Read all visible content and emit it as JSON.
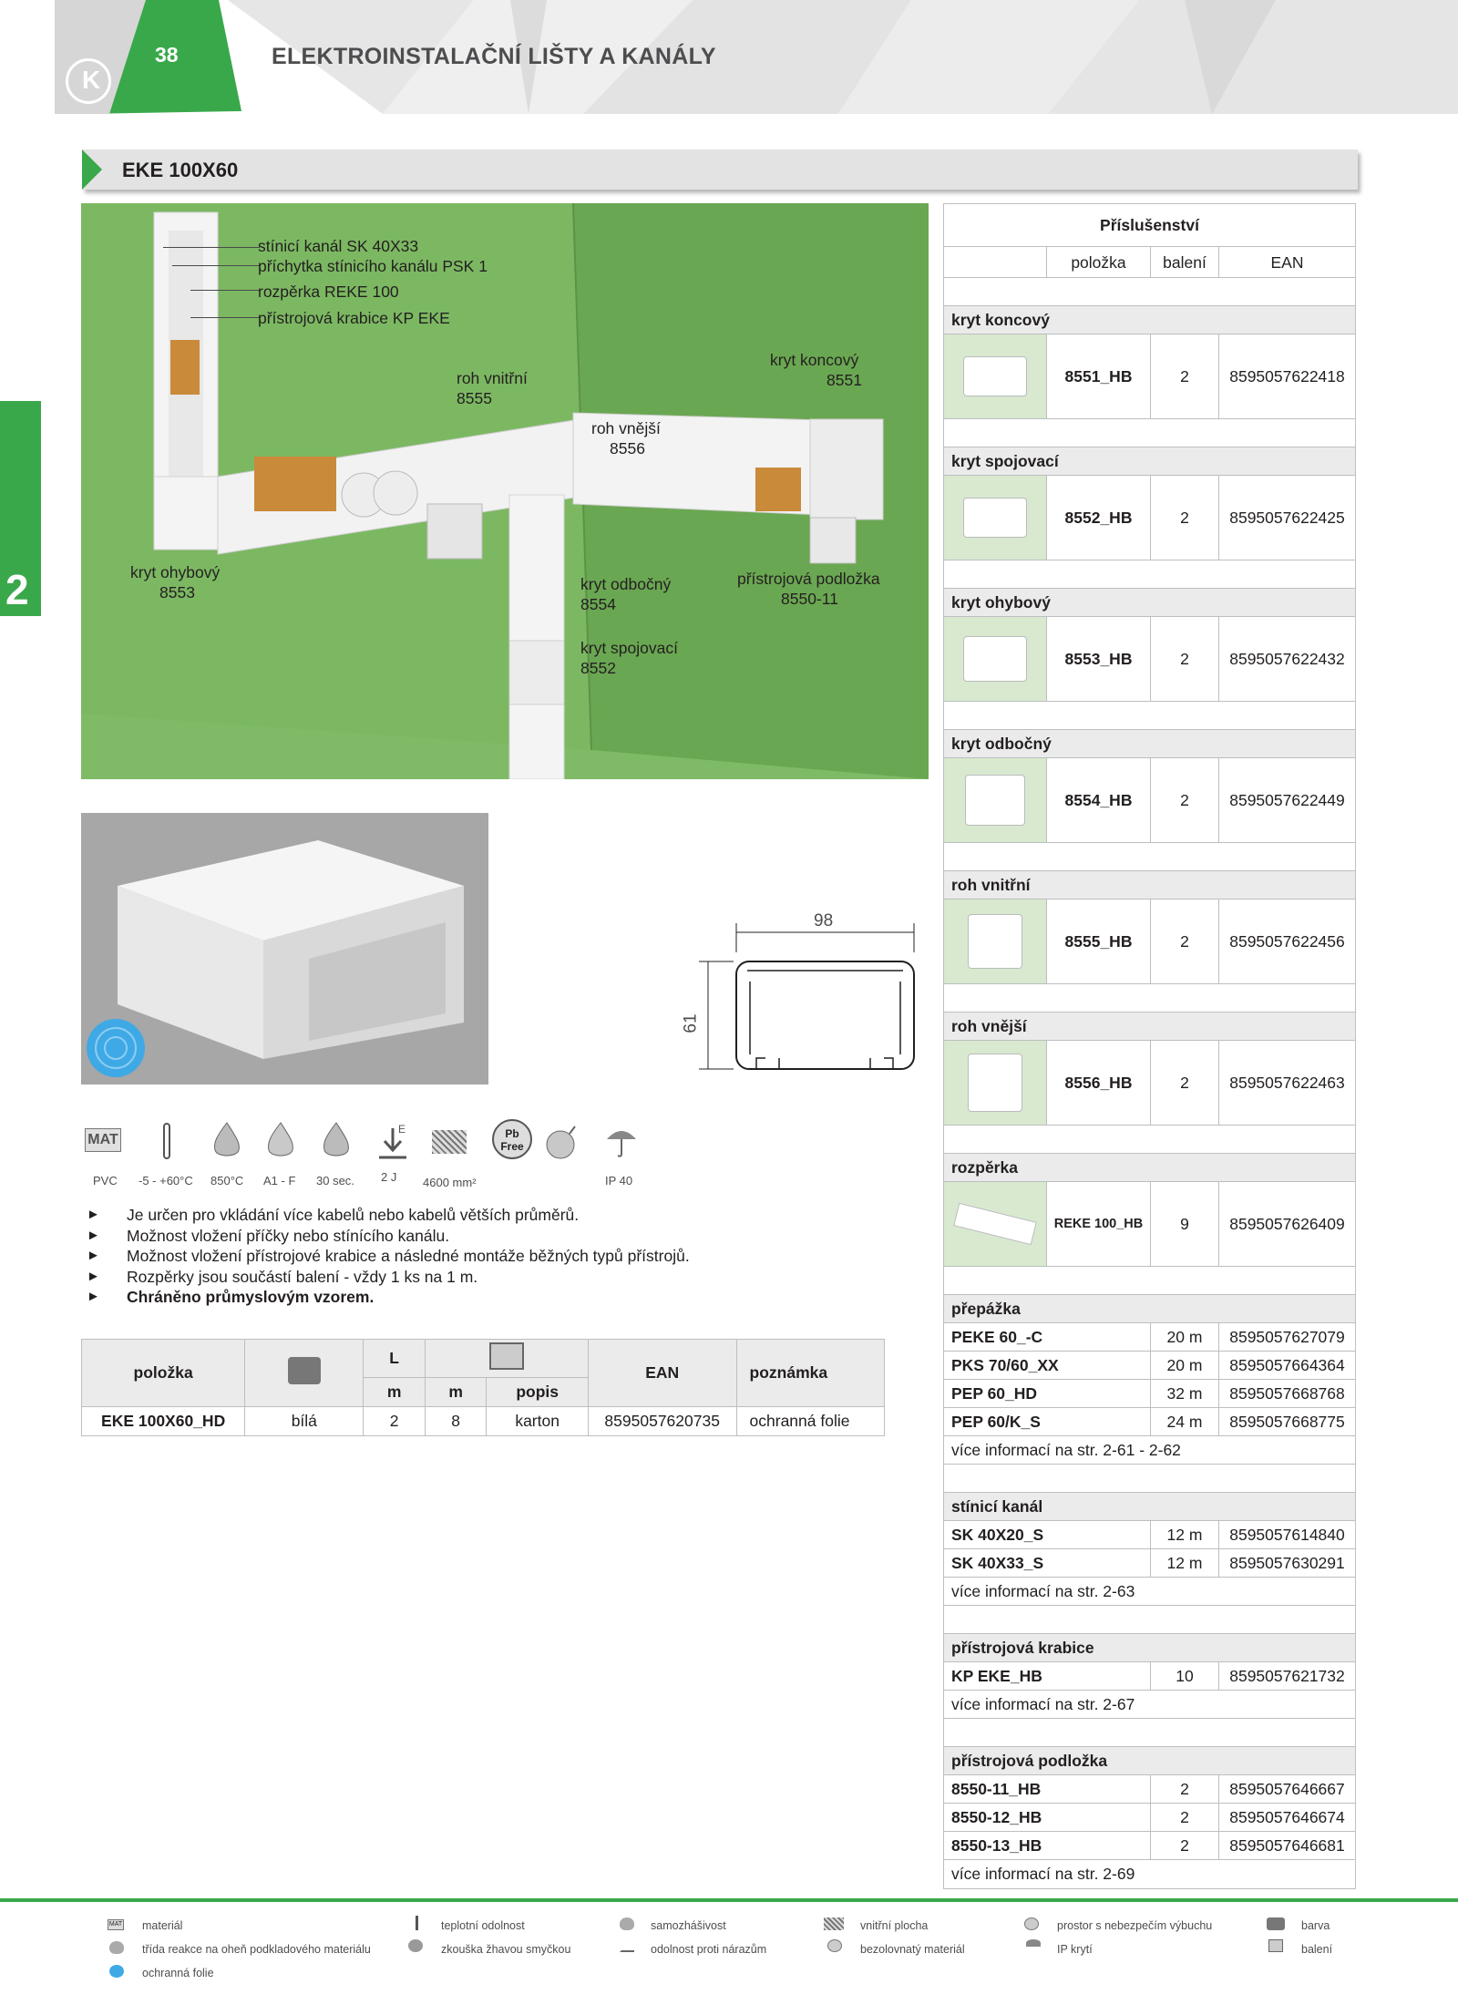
{
  "header": {
    "page_number": "38",
    "title": "ELEKTROINSTALAČNÍ LIŠTY A KANÁLY",
    "brand_color": "#39a84a"
  },
  "side_tab": {
    "label": "2"
  },
  "section": {
    "title": "EKE 100X60"
  },
  "photo_labels": [
    "stínicí kanál SK 40X33",
    "příchytka stínicího kanálu PSK 1",
    "rozpěrka REKE 100",
    "přístrojová krabice KP EKE",
    "roh vnitřní",
    "8555",
    "kryt koncový",
    "8551",
    "roh vnější",
    "8556",
    "kryt ohybový",
    "8553",
    "kryt odbočný",
    "8554",
    "přístrojová podložka",
    "8550-11",
    "kryt spojovací",
    "8552"
  ],
  "dimensions": {
    "width": "98",
    "height": "61"
  },
  "icon_labels": [
    "MAT",
    "PVC",
    "-5 - +60°C",
    "850°C",
    "A1 - F",
    "30 sec.",
    "E",
    "2 J",
    "4600 mm²",
    "Pb Free",
    "IP 40"
  ],
  "bullets": [
    "Je určen pro vkládání více kabelů nebo kabelů větších průměrů.",
    "Možnost vložení příčky nebo stínícího kanálu.",
    "Možnost vložení přístrojové krabice a následné montáže běžných typů přístrojů.",
    "Rozpěrky jsou součástí balení - vždy 1 ks na 1 m.",
    "Chráněno průmyslovým vzorem."
  ],
  "product_table": {
    "headers": {
      "item": "položka",
      "L": "L",
      "ean": "EAN",
      "note": "poznámka",
      "m1": "m",
      "m2": "m",
      "popis": "popis"
    },
    "row": {
      "item": "EKE 100X60_HD",
      "color": "bílá",
      "L": "2",
      "m": "8",
      "popis": "karton",
      "ean": "8595057620735",
      "note": "ochranná folie"
    }
  },
  "accessories": {
    "title": "Příslušenství",
    "cols": [
      "položka",
      "balení",
      "EAN"
    ],
    "items": [
      {
        "cat": "kryt koncový",
        "code": "8551_HB",
        "qty": "2",
        "ean": "8595057622418"
      },
      {
        "cat": "kryt spojovací",
        "code": "8552_HB",
        "qty": "2",
        "ean": "8595057622425"
      },
      {
        "cat": "kryt ohybový",
        "code": "8553_HB",
        "qty": "2",
        "ean": "8595057622432"
      },
      {
        "cat": "kryt odbočný",
        "code": "8554_HB",
        "qty": "2",
        "ean": "8595057622449"
      },
      {
        "cat": "roh vnitřní",
        "code": "8555_HB",
        "qty": "2",
        "ean": "8595057622456"
      },
      {
        "cat": "roh vnější",
        "code": "8556_HB",
        "qty": "2",
        "ean": "8595057622463"
      },
      {
        "cat": "rozpěrka",
        "code": "REKE 100_HB",
        "qty": "9",
        "ean": "8595057626409"
      }
    ],
    "groups": [
      {
        "cat": "přepážka",
        "lines": [
          {
            "n": "PEKE 60_-C",
            "q": "20 m",
            "e": "8595057627079"
          },
          {
            "n": "PKS 70/60_XX",
            "q": "20 m",
            "e": "8595057664364"
          },
          {
            "n": "PEP 60_HD",
            "q": "32 m",
            "e": "8595057668768"
          },
          {
            "n": "PEP 60/K_S",
            "q": "24 m",
            "e": "8595057668775"
          }
        ],
        "more": "více informací na str. 2-61 - 2-62"
      },
      {
        "cat": "stínicí kanál",
        "lines": [
          {
            "n": "SK 40X20_S",
            "q": "12 m",
            "e": "8595057614840"
          },
          {
            "n": "SK 40X33_S",
            "q": "12 m",
            "e": "8595057630291"
          }
        ],
        "more": "více informací na str. 2-63"
      },
      {
        "cat": "přístrojová krabice",
        "lines": [
          {
            "n": "KP EKE_HB",
            "q": "10",
            "e": "8595057621732"
          }
        ],
        "more": "více informací na str. 2-67"
      },
      {
        "cat": "přístrojová podložka",
        "lines": [
          {
            "n": "8550-11_HB",
            "q": "2",
            "e": "8595057646667"
          },
          {
            "n": "8550-12_HB",
            "q": "2",
            "e": "8595057646674"
          },
          {
            "n": "8550-13_HB",
            "q": "2",
            "e": "8595057646681"
          }
        ],
        "more": "více informací na str. 2-69"
      }
    ]
  },
  "footer_legend": [
    "MAT",
    "materiál",
    "teplotní odolnost",
    "samozhášivost",
    "vnitřní plocha",
    "prostor s nebezpečím výbuchu",
    "barva",
    "třída reakce na oheň podkladového materiálu",
    "zkouška žhavou smyčkou",
    "odolnost proti nárazům",
    "bezolovnatý materiál",
    "IP krytí",
    "balení",
    "ochranná folie"
  ]
}
